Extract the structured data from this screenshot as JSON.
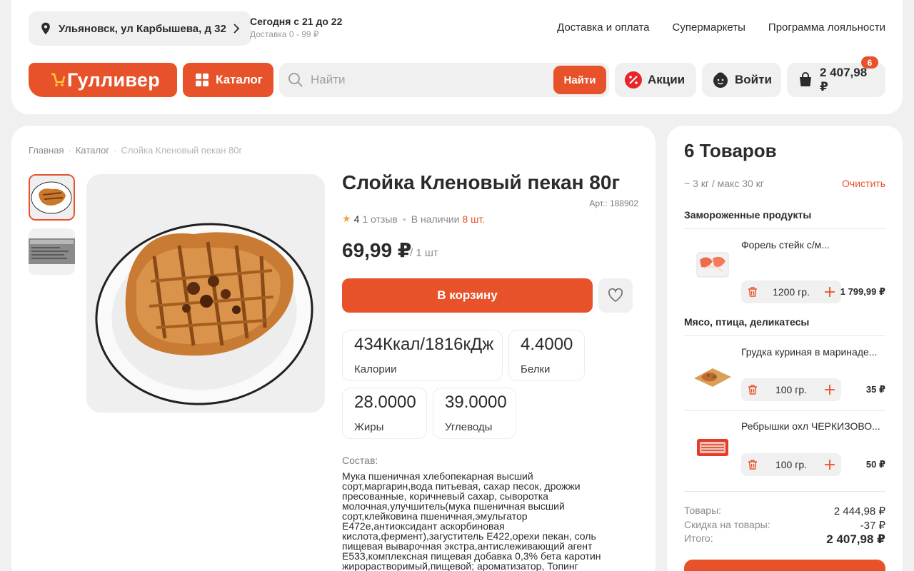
{
  "header": {
    "address": "Ульяновск, ул Карбышева, д 32",
    "delivery_time": "Сегодня с 21 до 22",
    "delivery_price": "Доставка 0 - 99 ₽",
    "links": [
      "Доставка и оплата",
      "Супермаркеты",
      "Программа лояльности"
    ],
    "logo_text": "Гулливер",
    "catalog_label": "Каталог",
    "search_placeholder": "Найти",
    "search_button": "Найти",
    "promo_label": "Акции",
    "login_label": "Войти",
    "cart_total": "2 407,98 ₽",
    "cart_count": "6"
  },
  "breadcrumbs": [
    "Главная",
    "Каталог",
    "Слойка Кленовый пекан 80г"
  ],
  "product": {
    "title": "Слойка Кленовый пекан 80г",
    "article": "Арт.: 188902",
    "rating": "4",
    "reviews": "1 отзыв",
    "availability": "В наличии",
    "stock": "8 шт.",
    "price": "69,99 ₽",
    "unit": "/ 1 шт",
    "add_to_cart": "В корзину",
    "nutrition": [
      {
        "value": "434Ккал/1816кДж",
        "label": "Калории"
      },
      {
        "value": "4.4000",
        "label": "Белки"
      },
      {
        "value": "28.0000",
        "label": "Жиры"
      },
      {
        "value": "39.0000",
        "label": "Углеводы"
      }
    ],
    "composition_title": "Состав:",
    "composition_lines": [
      "Мука пшеничная хлебопекарная высший",
      "сорт,маргарин,вода питьевая, сахар песок, дрожжи",
      "пресованные, коричневый сахар, сыворотка",
      "молочная,улучшитель(мука пшеничная высший",
      "сорт,клейковина пшеничная,эмульгатор",
      "Е472е,антиоксидант аскорбиновая",
      "кислота,фермент),загуститель Е422,орехи пекан, соль",
      "пищевая выварочная экстра,антислеживающий агент",
      "Е533,комплексная пищевая добавка 0,3% бета каротин",
      "жирорастворимый,пищевой; ароматизатор, Топинг"
    ]
  },
  "cart": {
    "title": "6 Товаров",
    "weight": "~ 3 кг / макс 30 кг",
    "clear": "Очистить",
    "categories": [
      {
        "name": "Замороженные продукты",
        "items": [
          {
            "name": "Форель стейк с/м...",
            "qty": "1200 гр.",
            "price": "1 799,99 ₽"
          }
        ]
      },
      {
        "name": "Мясо, птица, деликатесы",
        "items": [
          {
            "name": "Грудка куриная в маринаде...",
            "qty": "100 гр.",
            "price": "35 ₽"
          },
          {
            "name": "Ребрышки охл ЧЕРКИЗОВО...",
            "qty": "100 гр.",
            "price": "50 ₽"
          }
        ]
      }
    ],
    "totals": {
      "goods_label": "Товары:",
      "goods_value": "2 444,98 ₽",
      "discount_label": "Скидка на товары:",
      "discount_value": "-37 ₽",
      "total_label": "Итого:",
      "total_value": "2 407,98 ₽"
    }
  },
  "colors": {
    "accent": "#e8522a",
    "background": "#f0f0f0",
    "star": "#f2a33a"
  }
}
